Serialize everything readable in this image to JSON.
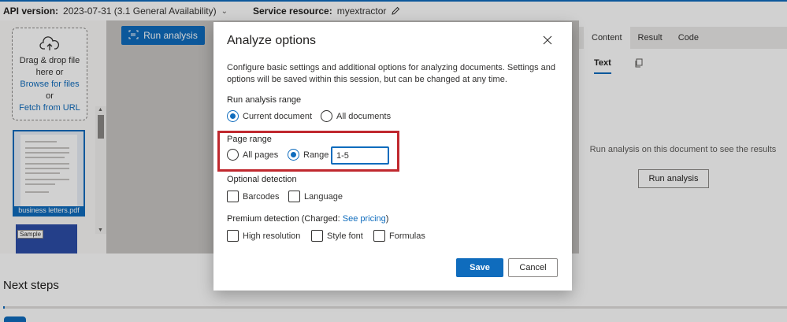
{
  "topbar": {
    "api_label": "API version:",
    "api_value": "2023-07-31 (3.1 General Availability)",
    "service_label": "Service resource:",
    "service_value": "myextractor"
  },
  "left_panel": {
    "drop_text": "Drag & drop file here or",
    "browse_link": "Browse for files",
    "or_text": "or",
    "fetch_link": "Fetch from URL",
    "file_name": "business letters.pdf",
    "sample_badge": "Sample"
  },
  "toolbar": {
    "run_analysis_label": "Run analysis"
  },
  "right_panel": {
    "tabs": [
      {
        "label": "Content",
        "active": true
      },
      {
        "label": "Result",
        "active": false
      },
      {
        "label": "Code",
        "active": false
      }
    ],
    "subtab": "Text",
    "hint": "Run analysis on this document to see the results",
    "run_analysis_label": "Run analysis"
  },
  "modal": {
    "title": "Analyze options",
    "description": "Configure basic settings and additional options for analyzing documents. Settings and options will be saved within this session, but can be changed at any time.",
    "run_range": {
      "label": "Run analysis range",
      "options": [
        "Current document",
        "All documents"
      ],
      "selected": "Current document"
    },
    "page_range": {
      "label": "Page range",
      "options": [
        "All pages",
        "Range"
      ],
      "selected": "Range",
      "range_value": "1-5"
    },
    "optional_detection": {
      "label": "Optional detection",
      "options": [
        "Barcodes",
        "Language"
      ]
    },
    "premium_detection": {
      "label_prefix": "Premium detection (Charged: ",
      "link": "See pricing",
      "label_suffix": ")",
      "options": [
        "High resolution",
        "Style font",
        "Formulas"
      ]
    },
    "save_label": "Save",
    "cancel_label": "Cancel"
  },
  "bottom": {
    "next_steps": "Next steps"
  },
  "colors": {
    "accent": "#0f6cbd",
    "highlight_border": "#c0282e"
  }
}
